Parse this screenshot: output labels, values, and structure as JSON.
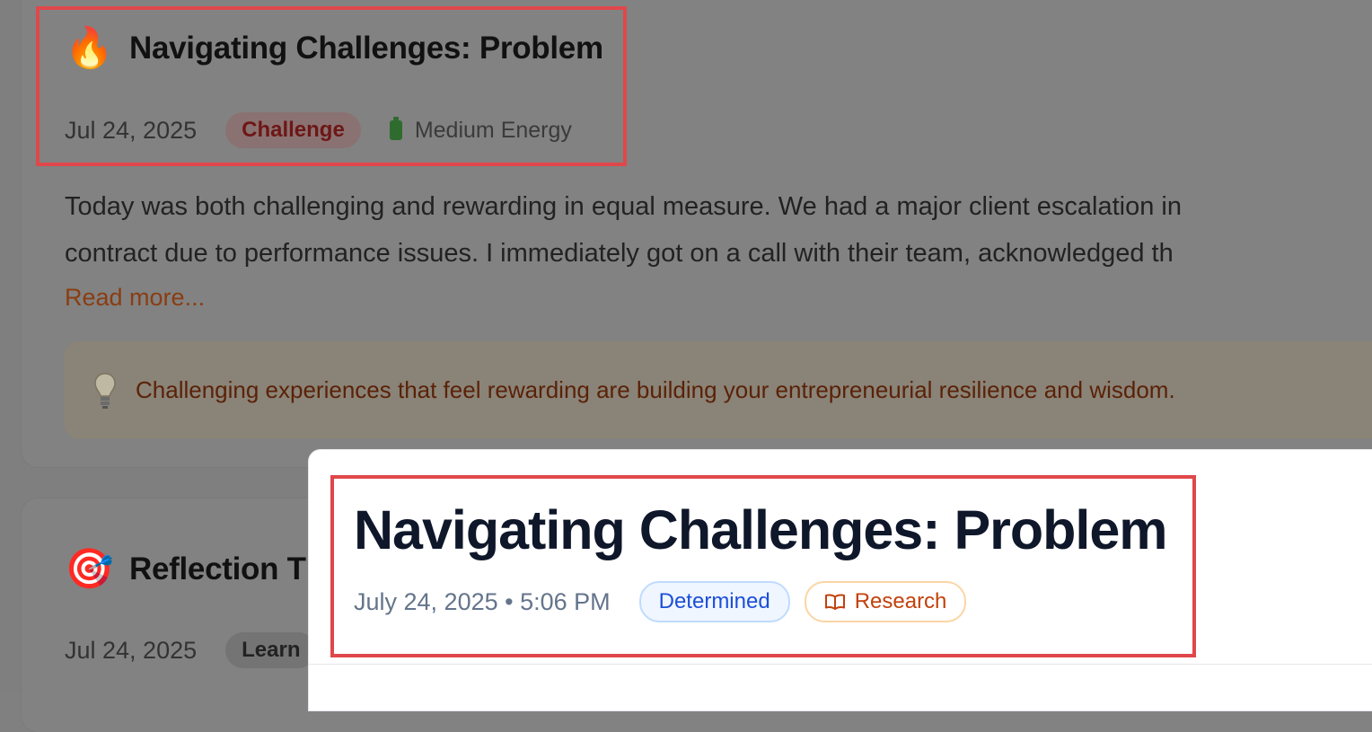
{
  "entries": [
    {
      "emoji": "🔥",
      "title": "Navigating Challenges: Problem",
      "date": "Jul 24, 2025",
      "tag": "Challenge",
      "energy": "Medium Energy",
      "body_line1": "Today was both challenging and rewarding in equal measure. We had a major client escalation in",
      "body_line2": "contract due to performance issues. I immediately got on a call with their team, acknowledged th",
      "read_more": "Read more...",
      "insight": "Challenging experiences that feel rewarding are building your entrepreneurial resilience and wisdom."
    },
    {
      "emoji": "🎯",
      "title": "Reflection T",
      "date": "Jul 24, 2025",
      "tag": "Learn"
    }
  ],
  "modal": {
    "title": "Navigating Challenges: Problem",
    "datetime": "July 24, 2025 • 5:06 PM",
    "tags": [
      "Determined",
      "Research"
    ]
  },
  "colors": {
    "highlight": "#e0474b",
    "challenge_tag": "#6e1616",
    "link": "#8a3d12",
    "determined": "#1d4ed8",
    "research": "#c2410c"
  },
  "icons": {
    "entry1": "fire-icon",
    "entry2": "target-icon",
    "energy": "battery-icon",
    "insight": "lightbulb-icon",
    "research": "book-icon"
  }
}
